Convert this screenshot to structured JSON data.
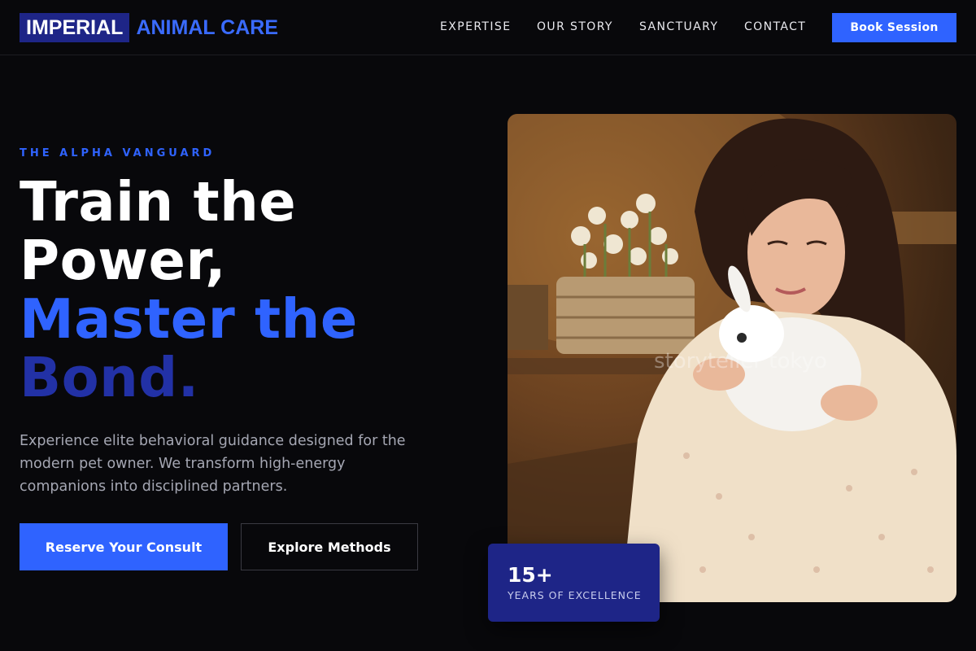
{
  "brand": {
    "logo_box": "IMPERIAL",
    "logo_rest": "ANIMAL CARE",
    "accent": "#2f63ff",
    "navy": "#1e2587"
  },
  "nav": {
    "items": [
      "EXPERTISE",
      "OUR STORY",
      "SANCTUARY",
      "CONTACT"
    ],
    "cta": "Book Session"
  },
  "hero": {
    "eyebrow": "THE ALPHA VANGUARD",
    "headline": [
      "Train the",
      "Power,",
      "Master the",
      "Bond."
    ],
    "description": "Experience elite behavioral guidance designed for the modern pet owner. We transform high-energy companions into disciplined partners.",
    "primary_cta": "Reserve Your Consult",
    "secondary_cta": "Explore Methods"
  },
  "image": {
    "watermark": "storyteller tokyo"
  },
  "stat": {
    "number": "15+",
    "label": "YEARS OF EXCELLENCE"
  }
}
